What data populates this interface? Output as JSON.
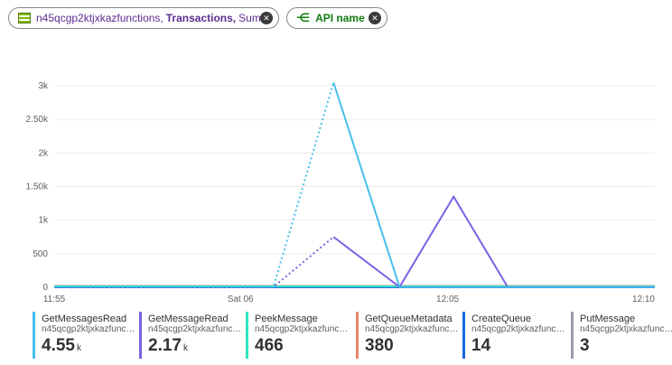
{
  "filters": {
    "metric_pill": {
      "resource": "n45qcgp2ktjxkazfunctions,",
      "metric": "Transactions,",
      "aggregation": "Sum"
    },
    "split_pill": {
      "label": "API name"
    },
    "close_glyph": "✕",
    "split_glyph": "⋲"
  },
  "chart_data": {
    "type": "line",
    "x": [
      "11:55",
      "Sat 06",
      "12:05",
      "12:10"
    ],
    "ylim": [
      0,
      3000
    ],
    "y_ticks": [
      "0",
      "500",
      "1k",
      "1.50k",
      "2k",
      "2.50k",
      "3k"
    ],
    "grid": true,
    "series": [
      {
        "name": "GetMessagesRead",
        "color": "#47bfec",
        "points": [
          [
            0,
            5
          ],
          [
            0.365,
            5
          ],
          [
            0.465,
            3050
          ],
          [
            0.575,
            5
          ],
          [
            1,
            5
          ]
        ],
        "dashed_until": 0.465
      },
      {
        "name": "GetMessageRead",
        "color": "#7b60e6",
        "points": [
          [
            0,
            5
          ],
          [
            0.365,
            5
          ],
          [
            0.465,
            750
          ],
          [
            0.575,
            5
          ],
          [
            0.665,
            1350
          ],
          [
            0.755,
            5
          ],
          [
            1,
            5
          ]
        ],
        "dashed_until": 0.465
      },
      {
        "name": "PeekMessage",
        "color": "#2ee6c0",
        "points": [
          [
            0,
            15
          ],
          [
            1,
            15
          ]
        ]
      },
      {
        "name": "GetQueueMetadata",
        "color": "#e8876a",
        "points": [
          [
            0,
            20
          ],
          [
            1,
            20
          ]
        ]
      },
      {
        "name": "CreateQueue",
        "color": "#1668e0",
        "points": [
          [
            0,
            2
          ],
          [
            1,
            2
          ]
        ]
      },
      {
        "name": "PutMessage",
        "color": "#9b9bab",
        "points": [
          [
            0,
            1
          ],
          [
            1,
            1
          ]
        ]
      }
    ]
  },
  "legend": [
    {
      "name": "GetMessagesRead",
      "resource": "n45qcgp2ktjxkazfunct...",
      "value": "4.55",
      "unit": "k",
      "color": "#47bfec"
    },
    {
      "name": "GetMessageRead",
      "resource": "n45qcgp2ktjxkazfunct...",
      "value": "2.17",
      "unit": "k",
      "color": "#7b60e6"
    },
    {
      "name": "PeekMessage",
      "resource": "n45qcgp2ktjxkazfunct...",
      "value": "466",
      "unit": "",
      "color": "#2ee6c0"
    },
    {
      "name": "GetQueueMetadata",
      "resource": "n45qcgp2ktjxkazfunct...",
      "value": "380",
      "unit": "",
      "color": "#e8876a"
    },
    {
      "name": "CreateQueue",
      "resource": "n45qcgp2ktjxkazfunct...",
      "value": "14",
      "unit": "",
      "color": "#1668e0"
    },
    {
      "name": "PutMessage",
      "resource": "n45qcgp2ktjxkazfunct...",
      "value": "3",
      "unit": "",
      "color": "#9b9bab"
    }
  ]
}
